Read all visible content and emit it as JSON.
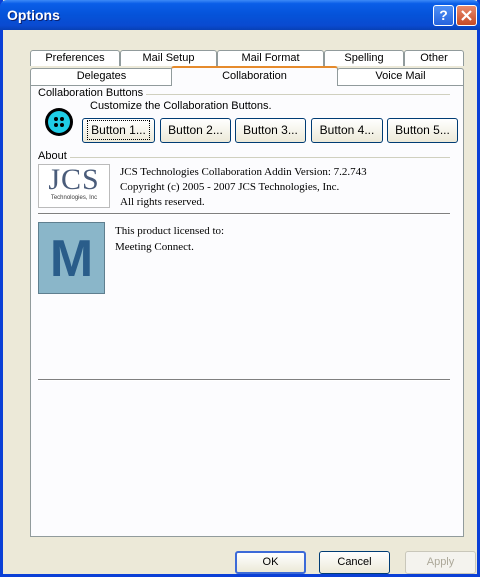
{
  "window": {
    "title": "Options"
  },
  "tabs_row1": [
    "Preferences",
    "Mail Setup",
    "Mail Format",
    "Spelling",
    "Other"
  ],
  "tabs_row2": [
    "Delegates",
    "Collaboration",
    "Voice Mail"
  ],
  "collab_group": {
    "label": "Collaboration Buttons",
    "description": "Customize the Collaboration Buttons.",
    "buttons": [
      "Button 1...",
      "Button 2...",
      "Button 3...",
      "Button 4...",
      "Button 5..."
    ]
  },
  "about": {
    "label": "About",
    "logo_text": "JCS",
    "logo_subtext": "Technologies, Inc",
    "line1": "JCS Technologies Collaboration Addin Version: 7.2.743",
    "line2": "Copyright (c) 2005 - 2007 JCS Technologies, Inc.",
    "line3": "All rights reserved."
  },
  "license": {
    "logo_letter": "M",
    "line1": "This product licensed to:",
    "line2": "Meeting Connect."
  },
  "footer": {
    "ok": "OK",
    "cancel": "Cancel",
    "apply": "Apply"
  }
}
